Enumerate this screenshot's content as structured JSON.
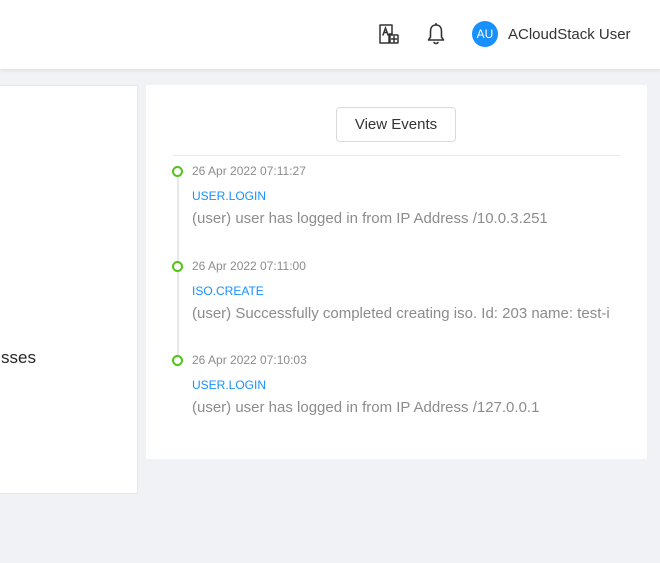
{
  "header": {
    "avatar_initials": "AU",
    "avatar_color": "#1890ff",
    "user_name": "ACloudStack User",
    "icons": [
      "translate-icon",
      "bell-icon"
    ]
  },
  "left_card": {
    "partial_text": "sses"
  },
  "events_card": {
    "view_events_label": "View Events",
    "events": [
      {
        "time": "26 Apr 2022 07:11:27",
        "type": "USER.LOGIN",
        "description": "(user) user has logged in from IP Address /10.0.3.251"
      },
      {
        "time": "26 Apr 2022 07:11:00",
        "type": "ISO.CREATE",
        "description": "(user) Successfully completed creating iso. Id: 203 name: test-i"
      },
      {
        "time": "26 Apr 2022 07:10:03",
        "type": "USER.LOGIN",
        "description": "(user) user has logged in from IP Address /127.0.0.1"
      }
    ],
    "dot_color": "#52c41a",
    "link_color": "#1890ff"
  }
}
